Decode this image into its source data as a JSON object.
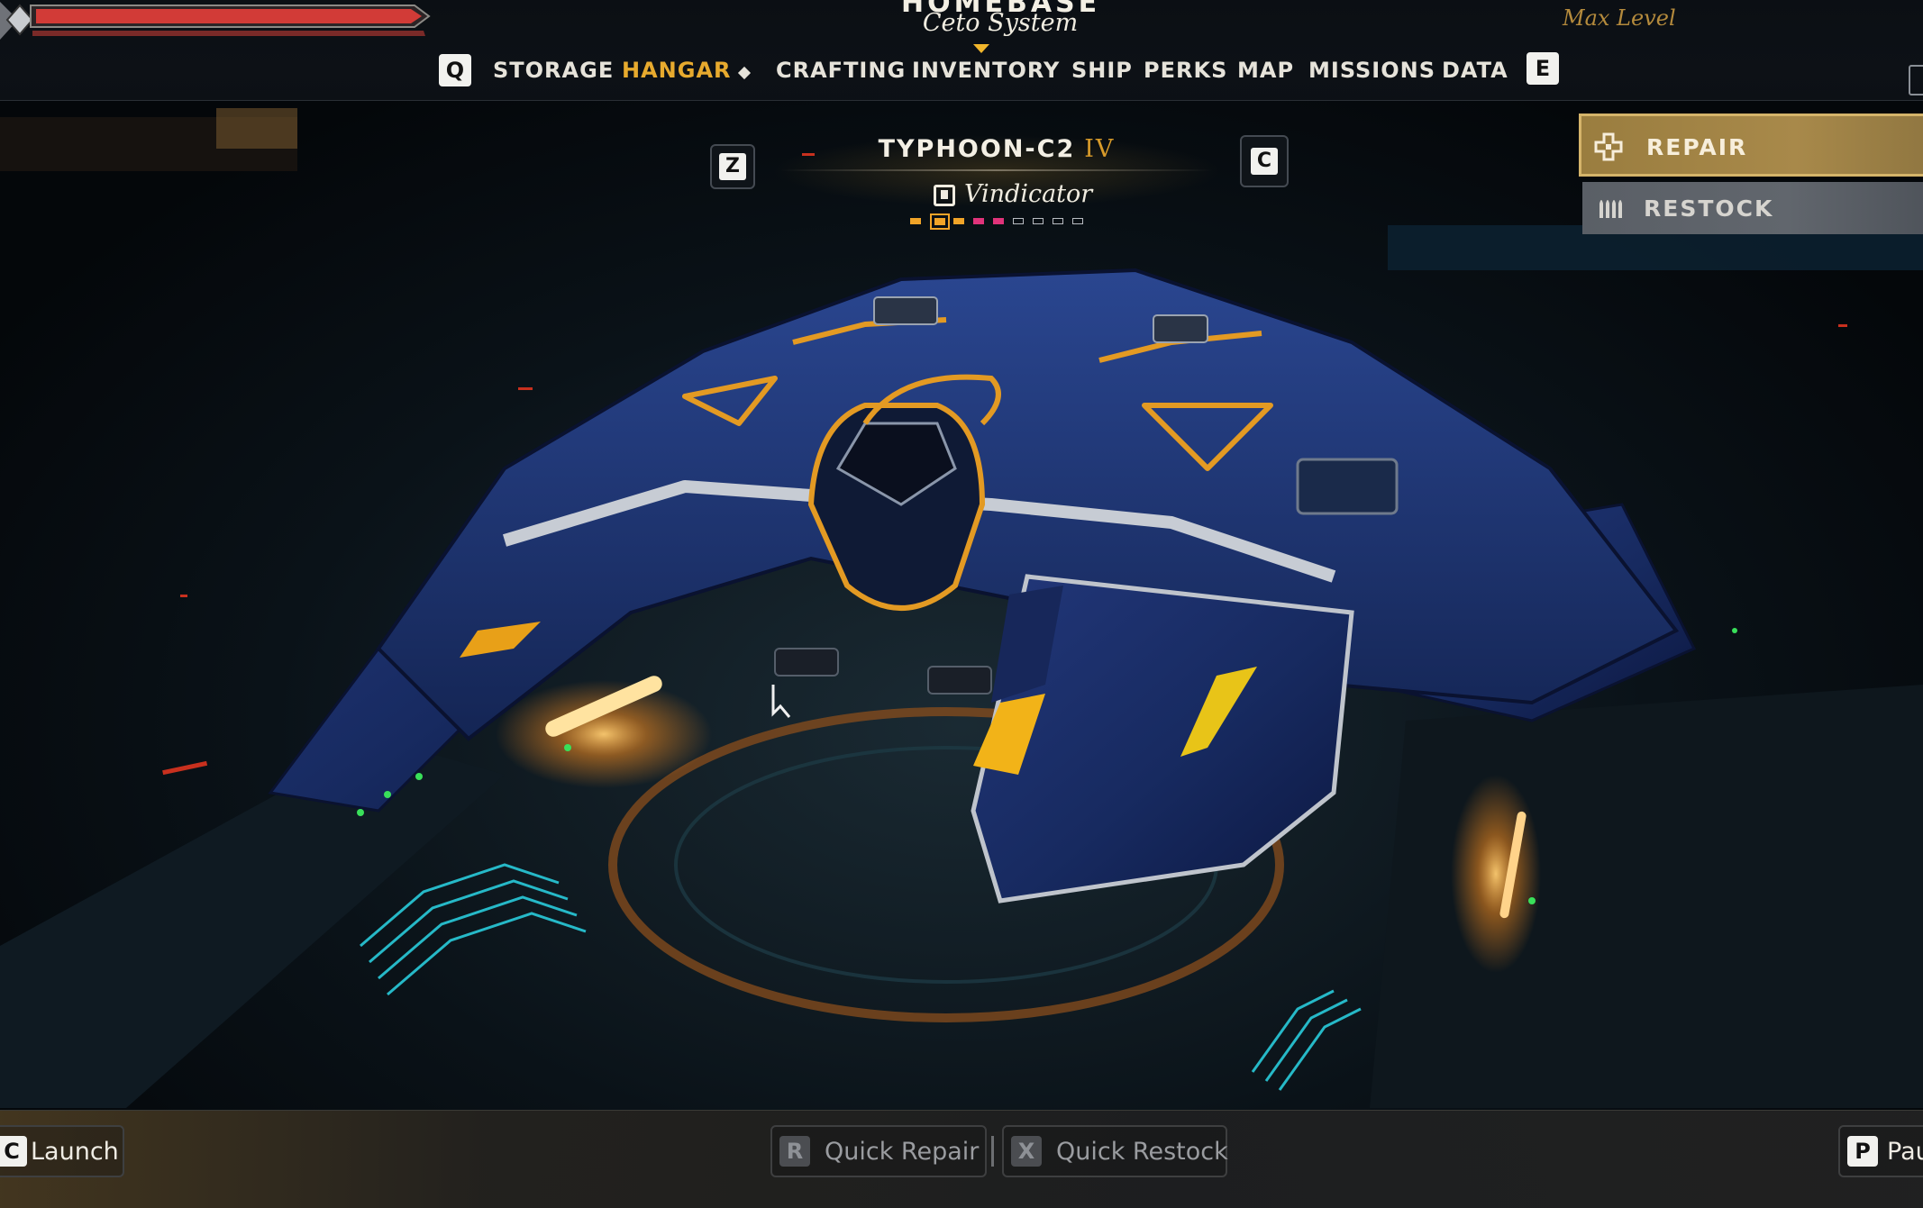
{
  "hud": {
    "location_title": "HOMEBASE",
    "location_subtitle": "Ceto System",
    "level_text": "Max Level"
  },
  "nav": {
    "prev_key": "Q",
    "next_key": "E",
    "tabs": [
      {
        "label": "STORAGE",
        "active": false
      },
      {
        "label": "HANGAR",
        "active": true
      },
      {
        "label": "CRAFTING",
        "active": false
      },
      {
        "label": "INVENTORY",
        "active": false
      },
      {
        "label": "SHIP",
        "active": false
      },
      {
        "label": "PERKS",
        "active": false
      },
      {
        "label": "MAP",
        "active": false
      },
      {
        "label": "MISSIONS",
        "active": false
      },
      {
        "label": "DATA",
        "active": false
      }
    ]
  },
  "ship": {
    "prev_key": "Z",
    "next_key": "C",
    "name": "TYPHOON-C2",
    "tier": "IV",
    "class": "Vindicator",
    "selector": {
      "total": 9,
      "selected_index": 1,
      "pips": [
        "orange",
        "orange",
        "orange",
        "pink",
        "pink",
        "empty",
        "empty",
        "empty",
        "empty"
      ]
    }
  },
  "actions": {
    "repair_label": "REPAIR",
    "restock_label": "RESTOCK"
  },
  "hints": {
    "launch": {
      "key": "C",
      "label": "Launch"
    },
    "quick_repair": {
      "key": "R",
      "label": "Quick Repair"
    },
    "quick_restock": {
      "key": "X",
      "label": "Quick Restock"
    },
    "pause": {
      "key": "P",
      "label": "Pause"
    }
  },
  "colors": {
    "accent_gold": "#e7aa2e",
    "health_red": "#d23b37",
    "ship_hull": "#1a2d63",
    "ship_trim": "#e39a23",
    "hangar_cyan": "#2bd6e6"
  },
  "icons": {
    "repair": "wrench-plus-icon",
    "restock": "ammo-icon",
    "ship_class": "emblem-icon"
  }
}
